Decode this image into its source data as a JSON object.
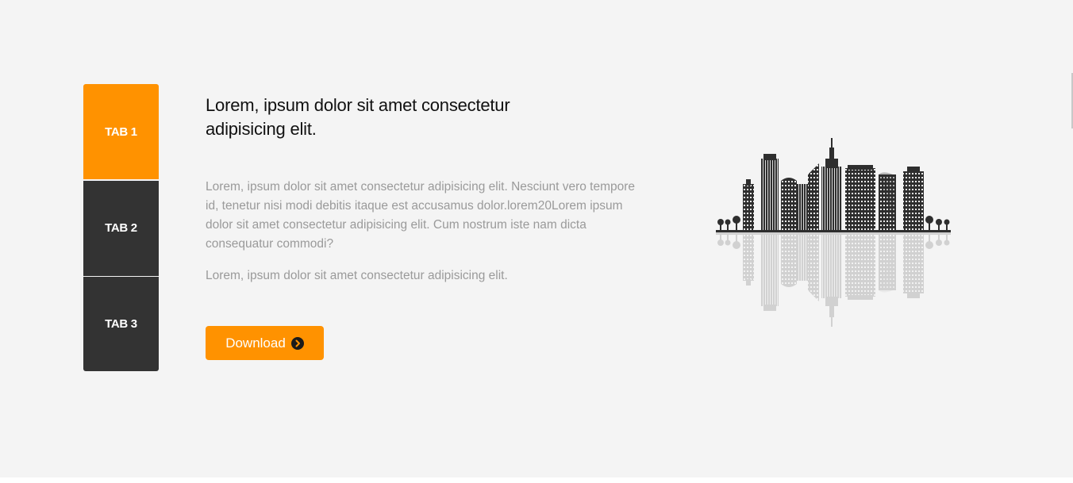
{
  "tabs": [
    {
      "label": "TAB 1",
      "active": true
    },
    {
      "label": "TAB 2",
      "active": false
    },
    {
      "label": "TAB 3",
      "active": false
    }
  ],
  "content": {
    "heading": "Lorem, ipsum dolor sit amet consectetur adipisicing elit.",
    "paragraph_1": "Lorem, ipsum dolor sit amet consectetur adipisicing elit. Nesciunt vero tempore id, tenetur nisi modi debitis itaque est accusamus dolor.lorem20Lorem ipsum dolor sit amet consectetur adipisicing elit. Cum nostrum iste nam dicta consequatur commodi?",
    "paragraph_2": "Lorem, ipsum dolor sit amet consectetur adipisicing elit.",
    "download_label": "Download"
  },
  "icons": {
    "download": "chevron-circle-right-icon",
    "illustration": "city-skyline-illustration"
  },
  "colors": {
    "accent": "#ff9200",
    "tab_inactive": "#333333",
    "background": "#f4f4f4",
    "heading": "#111111",
    "body_text": "#9a9a9a"
  }
}
